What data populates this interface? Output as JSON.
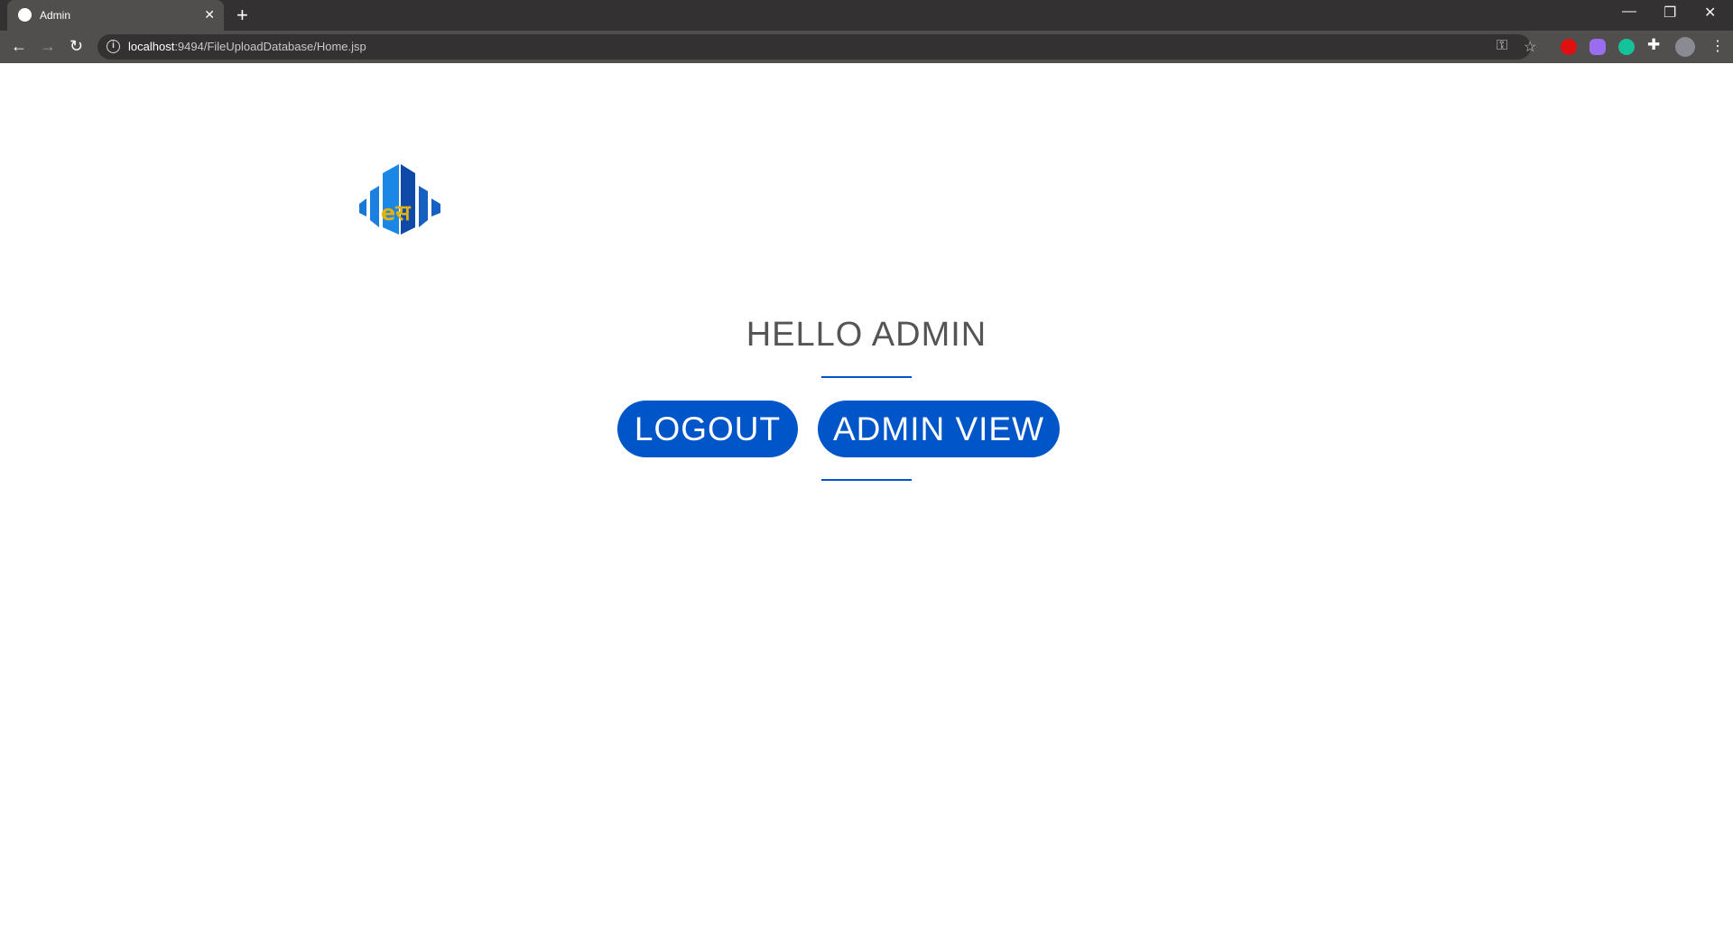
{
  "browser": {
    "tab_title": "Admin",
    "new_tab": "+",
    "tab_close": "✕",
    "url_host": "localhost",
    "url_rest": ":9494/FileUploadDatabase/Home.jsp"
  },
  "page": {
    "heading": "HELLO ADMIN",
    "logout_label": "LOGOUT",
    "admin_view_label": "ADMIN VIEW",
    "accent_color": "#0055c8"
  }
}
